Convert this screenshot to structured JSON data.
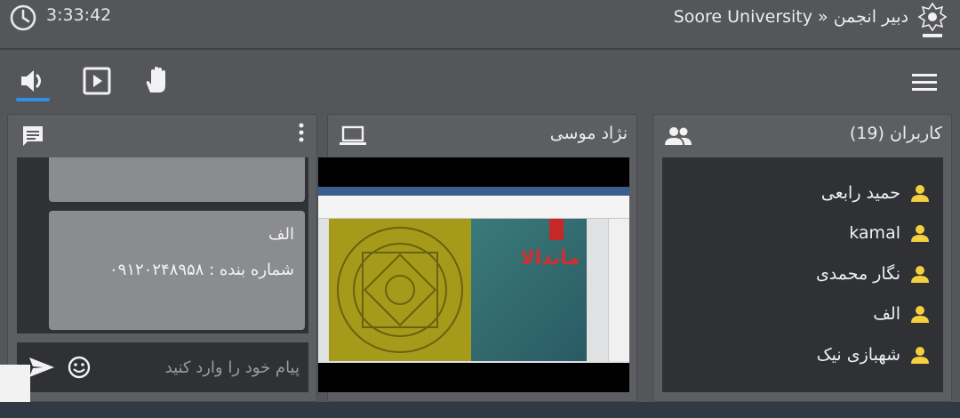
{
  "header": {
    "time": "3:33:42",
    "breadcrumb": "Soore University » دبیر انجمن"
  },
  "chat": {
    "messages": [
      {
        "author": "الف",
        "body": "شماره بنده :  ۰۹۱۲۰۲۴۸۹۵۸"
      }
    ],
    "input_placeholder": "پیام خود را وارد کنید"
  },
  "presenter": {
    "name": "نژاد موسی",
    "slide_heading": "ماندالا"
  },
  "users": {
    "title": "کاربران (19)",
    "list": [
      {
        "name": "حمید رابعی"
      },
      {
        "name": "kamal"
      },
      {
        "name": "نگار محمدی"
      },
      {
        "name": "الف"
      },
      {
        "name": "شهبازی نیک"
      }
    ]
  },
  "colors": {
    "accent": "#2f8fe6",
    "user_icon": "#f4d03f",
    "panel_bg": "#5c5e61",
    "list_bg": "#2f3134"
  },
  "icons": {
    "clock": "clock-icon",
    "audio": "speaker-icon",
    "present": "play-box-icon",
    "raise_hand": "hand-icon",
    "menu": "hamburger-icon",
    "chat": "chat-bubble-icon",
    "screen": "laptop-icon",
    "users": "people-icon",
    "emoji": "smiley-icon",
    "send": "send-icon"
  }
}
